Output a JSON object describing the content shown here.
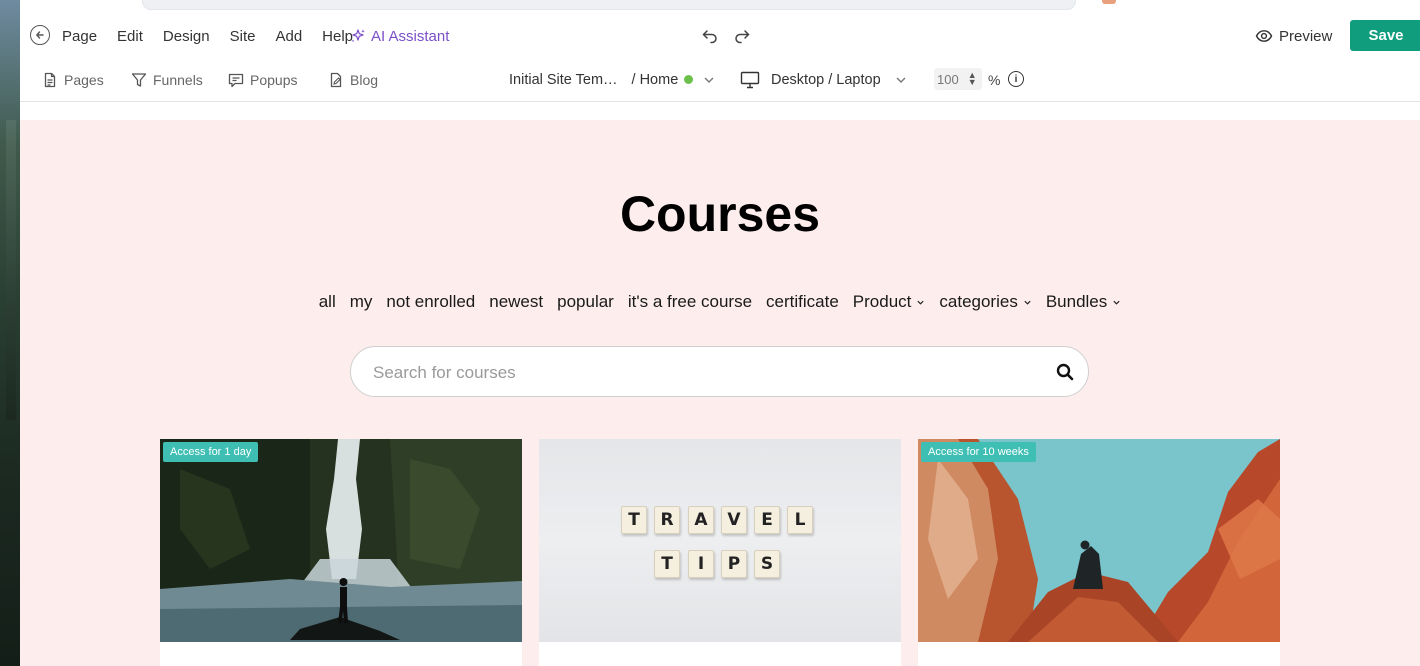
{
  "menubar": {
    "items": [
      "Page",
      "Edit",
      "Design",
      "Site",
      "Add",
      "Help"
    ],
    "ai_assistant": "AI Assistant",
    "preview": "Preview",
    "save": "Save"
  },
  "toolbar": {
    "pages": "Pages",
    "funnels": "Funnels",
    "popups": "Popups",
    "blog": "Blog",
    "site_name": "Initial Site Tem…",
    "page_name": "/ Home",
    "device": "Desktop / Laptop",
    "zoom_value": "100",
    "zoom_unit": "%",
    "info_glyph": "i"
  },
  "canvas": {
    "heading": "Courses",
    "filters": [
      "all",
      "my",
      "not enrolled",
      "newest",
      "popular",
      "it's a free course",
      "certificate"
    ],
    "dropdowns": [
      "Product",
      "categories",
      "Bundles"
    ],
    "search_placeholder": "Search for courses",
    "cards": [
      {
        "badge": "Access for 1 day",
        "image": "waterfall-photo"
      },
      {
        "badge": "",
        "image": "travel-tips-tiles-photo",
        "tiles_row1": [
          "T",
          "R",
          "A",
          "V",
          "E",
          "L"
        ],
        "tiles_row2": [
          "T",
          "I",
          "P",
          "S"
        ]
      },
      {
        "badge": "Access for 10 weeks",
        "image": "red-canyon-photo"
      }
    ]
  },
  "colors": {
    "save_button": "#0f9d7e",
    "ai_purple": "#7b4fc9",
    "canvas_bg": "#fdeeed",
    "badge_teal": "#3fbfb4",
    "status_green": "#6cc04a"
  }
}
